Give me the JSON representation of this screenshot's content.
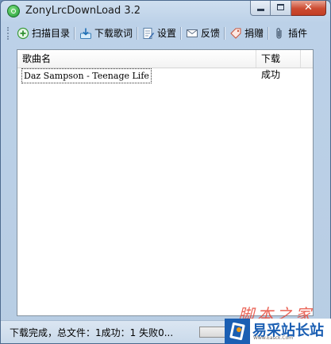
{
  "window": {
    "title": "ZonyLrcDownLoad 3.2"
  },
  "toolbar": {
    "items": [
      {
        "label": "扫描目录",
        "icon": "plus-circle-icon"
      },
      {
        "label": "下载歌词",
        "icon": "download-tray-icon"
      },
      {
        "label": "设置",
        "icon": "settings-notepad-icon"
      },
      {
        "label": "反馈",
        "icon": "envelope-icon"
      },
      {
        "label": "捐赠",
        "icon": "tag-icon"
      },
      {
        "label": "插件",
        "icon": "paperclip-icon"
      }
    ]
  },
  "list": {
    "columns": [
      "歌曲名",
      "下载"
    ],
    "rows": [
      {
        "name": "Daz Sampson - Teenage Life",
        "status": "成功"
      }
    ]
  },
  "status": {
    "text": "下载完成，总文件：1成功：1 失败0..."
  },
  "watermark": {
    "text": "脚本之家",
    "brand": "易采站长站",
    "url": "Www.Easck.Com"
  },
  "colors": {
    "accent": "#1b5fb3",
    "close": "#c94a32",
    "watermark": "#e74b3c"
  }
}
